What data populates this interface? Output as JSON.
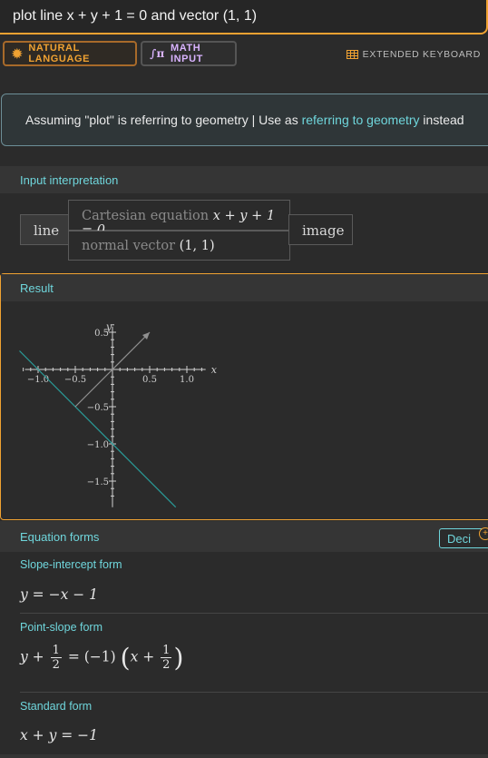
{
  "query": {
    "text": "plot line x + y + 1 = 0 and vector (1, 1)"
  },
  "modes": {
    "natural_language": "NATURAL LANGUAGE",
    "math_input": "MATH INPUT",
    "extended_keyboard": "EXTENDED KEYBOARD"
  },
  "assumption": {
    "prefix": "Assuming \"plot\" is referring to geometry | Use as ",
    "link": "referring to geometry",
    "suffix": " instead"
  },
  "input_interpretation": {
    "title": "Input interpretation",
    "line_label": "line",
    "image_label": "image",
    "equation_label": "Cartesian equation",
    "equation": "x + y + 1 = 0",
    "normal_label": "normal vector",
    "normal": "(1, 1)"
  },
  "result": {
    "title": "Result",
    "chart_data": {
      "type": "line",
      "xlabel": "x",
      "ylabel": "y",
      "xlim": [
        -1.25,
        1.35
      ],
      "ylim": [
        -1.85,
        0.65
      ],
      "x_ticks": [
        -1.0,
        -0.5,
        0.5,
        1.0
      ],
      "x_tick_labels": [
        "−1.0",
        "−0.5",
        "0.5",
        "1.0"
      ],
      "y_ticks": [
        0.5,
        -0.5,
        -1.0,
        -1.5
      ],
      "y_tick_labels": [
        "0.5",
        "−0.5",
        "−1.0",
        "−1.5"
      ],
      "line": {
        "x": [
          -1.25,
          0.85
        ],
        "y": [
          0.25,
          -1.85
        ],
        "color": "#2a9d9a"
      },
      "vectors": [
        {
          "from": [
            -0.5,
            -0.5
          ],
          "to": [
            0,
            0
          ],
          "color": "#909090"
        },
        {
          "from": [
            0,
            0
          ],
          "to": [
            0.5,
            0.5
          ],
          "color": "#909090"
        }
      ]
    }
  },
  "equation_forms": {
    "title": "Equation forms",
    "button": "Deci",
    "forms": [
      {
        "label": "Slope-intercept form",
        "math": "y = −x − 1"
      },
      {
        "label": "Point-slope form",
        "lhs": "y +",
        "frac1_num": "1",
        "frac1_den": "2",
        "mid": " = (−1)",
        "inner": "x +",
        "frac2_num": "1",
        "frac2_den": "2"
      },
      {
        "label": "Standard form",
        "math": "x + y = −1"
      }
    ]
  }
}
